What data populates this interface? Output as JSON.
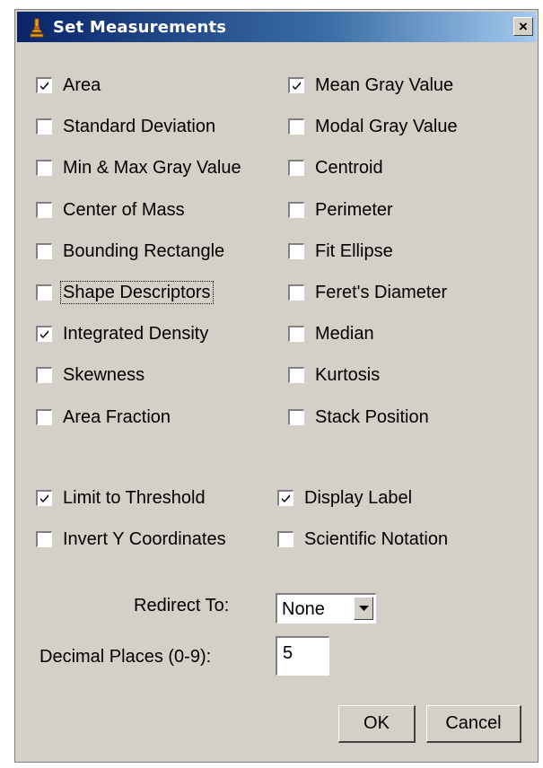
{
  "window": {
    "title": "Set Measurements",
    "icon": "microscope-icon",
    "close_label": "×",
    "title_gradient": [
      "#0a246a",
      "#a6caf0"
    ]
  },
  "measurements": [
    {
      "label": "Area",
      "checked": true
    },
    {
      "label": "Mean Gray Value",
      "checked": true
    },
    {
      "label": "Standard Deviation",
      "checked": false
    },
    {
      "label": "Modal Gray Value",
      "checked": false
    },
    {
      "label": "Min & Max Gray Value",
      "checked": false
    },
    {
      "label": "Centroid",
      "checked": false
    },
    {
      "label": "Center of Mass",
      "checked": false
    },
    {
      "label": "Perimeter",
      "checked": false
    },
    {
      "label": "Bounding Rectangle",
      "checked": false
    },
    {
      "label": "Fit Ellipse",
      "checked": false
    },
    {
      "label": "Shape Descriptors",
      "checked": false,
      "focused": true
    },
    {
      "label": "Feret's Diameter",
      "checked": false
    },
    {
      "label": "Integrated Density",
      "checked": true
    },
    {
      "label": "Median",
      "checked": false
    },
    {
      "label": "Skewness",
      "checked": false
    },
    {
      "label": "Kurtosis",
      "checked": false
    },
    {
      "label": "Area Fraction",
      "checked": false
    },
    {
      "label": "Stack Position",
      "checked": false
    }
  ],
  "options": [
    {
      "label": "Limit to Threshold",
      "checked": true
    },
    {
      "label": "Display Label",
      "checked": true
    },
    {
      "label": "Invert Y Coordinates",
      "checked": false
    },
    {
      "label": "Scientific Notation",
      "checked": false
    }
  ],
  "redirect": {
    "label": "Redirect To:",
    "value": "None"
  },
  "decimal": {
    "label": "Decimal Places (0-9):",
    "value": "5"
  },
  "buttons": {
    "ok": "OK",
    "cancel": "Cancel"
  },
  "colors": {
    "dialog_bg": "#d4d0c8",
    "title_text": "#ffffff"
  }
}
